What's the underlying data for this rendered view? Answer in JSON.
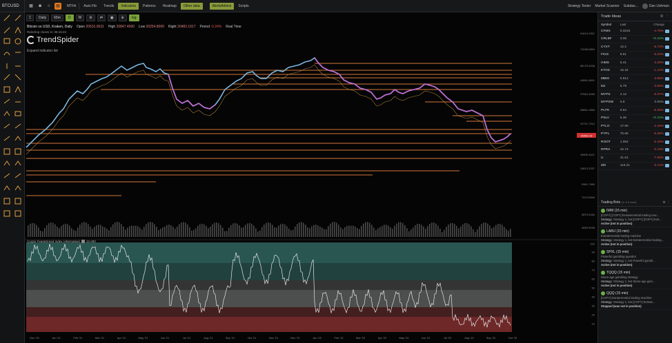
{
  "topbar": {
    "ticker": "BTCUSD",
    "buttons": [
      "MTFA",
      "Auto Fib",
      "Trends",
      "Indicators",
      "Patterns",
      "Heatmap",
      "Other data",
      "AlertsAdvice",
      "Scripts"
    ],
    "right": [
      "Strategy Tester",
      "Market Scanner",
      "Subdas..."
    ],
    "user": "Dan Ushman"
  },
  "chart_toolbar": {
    "interval": "Daily",
    "resolution": "65m",
    "mode_d": "D",
    "mode_w": "W"
  },
  "chart_info": {
    "pair": "Bitcoin vs USD, Kraken, Daily",
    "open_label": "Open",
    "open": "20531.0531",
    "high_label": "High",
    "high": "20847.4000",
    "low_label": "Low",
    "low": "20254.8000",
    "right_label": "Right",
    "right": "20482.1917",
    "period_label": "Period",
    "period": "-0.24%",
    "realtime": "Real Time",
    "rainshop": "Raindrop closes in: 06:15:24",
    "logo": "TrendSpider",
    "expand": "Expand indicator list"
  },
  "indicator": {
    "title": "Crypto Fear&Greed Index (Alternative)",
    "value": "22.000"
  },
  "y_axis_main": [
    "91813.2357",
    "71938.0854",
    "56175.4938",
    "43681.6851",
    "37584.3286",
    "28851.1866",
    "22721.7312",
    "18906.4421",
    "13813.2257",
    "9361.7980",
    "7419.0845",
    "5879.4166",
    "4659.5038"
  ],
  "price_tag": "20482.19",
  "y_axis_ind": [
    "100",
    "90",
    "80",
    "70",
    "60",
    "50",
    "40",
    "30",
    "20",
    "10"
  ],
  "x_axis": [
    "Dec '20",
    "Jan '21",
    "Feb '21",
    "Mar '21",
    "Apr '21",
    "May '21",
    "Jun '21",
    "Jul '21",
    "Aug '21",
    "Sep '21",
    "Oct '21",
    "Nov '21",
    "Dec '21",
    "Jan '22",
    "Feb '22",
    "Mar '22",
    "Apr '22",
    "May '22",
    "Jun '22",
    "Jul '22",
    "Aug '22",
    "Sep '22",
    "Oct '22"
  ],
  "sidebar": {
    "title": "Trade Ideas",
    "columns": [
      "Symbol",
      "Last",
      "Change"
    ],
    "rows": [
      {
        "sym": "CFMS",
        "last": "0.3245",
        "chg": "-4.76%",
        "dir": "neg"
      },
      {
        "sym": "CRLBF",
        "last": "3.06",
        "chg": "+0.23%",
        "dir": "pos"
      },
      {
        "sym": "CYXT",
        "last": "12.2",
        "chg": "-5.72%",
        "dir": "neg"
      },
      {
        "sym": "FIGS",
        "last": "9.61",
        "chg": "-5.23%",
        "dir": "neg"
      },
      {
        "sym": "HIMS",
        "last": "5.41",
        "chg": "-3.39%",
        "dir": "neg"
      },
      {
        "sym": "KTOS",
        "last": "15.34",
        "chg": "-1.14%",
        "dir": "neg"
      },
      {
        "sym": "MBIO",
        "last": "0.612",
        "chg": "-3.65%",
        "dir": "neg"
      },
      {
        "sym": "MJ",
        "last": "5.79",
        "chg": "-3.80%",
        "dir": "neg"
      },
      {
        "sym": "MYPS",
        "last": "4.12",
        "chg": "-6.37%",
        "dir": "neg"
      },
      {
        "sym": "MYPSW",
        "last": "0.9",
        "chg": "0.00%",
        "dir": "zero"
      },
      {
        "sym": "PLTR",
        "last": "8.64",
        "chg": "-5.25%",
        "dir": "neg"
      },
      {
        "sym": "PSLV",
        "last": "6.36",
        "chg": "+0.10%",
        "dir": "pos"
      },
      {
        "sym": "PTLO",
        "last": "17.90",
        "chg": "-2.18%",
        "dir": "neg"
      },
      {
        "sym": "PYPL",
        "last": "70.65",
        "chg": "-5.28%",
        "dir": "neg"
      },
      {
        "sym": "ROOT",
        "last": "1.054",
        "chg": "-5.18%",
        "dir": "neg"
      },
      {
        "sym": "RPRX",
        "last": "42.74",
        "chg": "-0.19%",
        "dir": "neg"
      },
      {
        "sym": "U",
        "last": "41.61",
        "chg": "-7.58%",
        "dir": "neg"
      },
      {
        "sym": "ZM",
        "last": "116.21",
        "chg": "-3.13%",
        "dir": "neg"
      }
    ]
  },
  "bots": {
    "title": "Trading Bots",
    "subtitle": "(4 of 5 used)",
    "items": [
      {
        "title": "IWM (15 min)",
        "desc": "[COPY] [COPY] Extraterrestrial trading mac...",
        "strategy_label": "Strategy:",
        "strategy": "Strategy 1, bot [COPY] [COPY] Extr...",
        "status": "Active (not in position)"
      },
      {
        "title": "LABU (15 min)",
        "desc": "Extraterrestrial trading machine",
        "strategy_label": "Strategy:",
        "strategy": "Strategy 1, bot Extraterrestrial trading...",
        "status": "Active (not in position)"
      },
      {
        "title": "SPXL (15 min)",
        "desc": "Powerful gambling quanbot",
        "strategy_label": "Strategy:",
        "strategy": "Strategy 1, bot Powerful gambl...",
        "status": "Active (not in position)"
      },
      {
        "title": "TQQQ (15 min)",
        "desc": "Stone-age gambling strategy",
        "strategy_label": "Strategy:",
        "strategy": "Strategy 1, bot Stone-age gam...",
        "status": "Active (not in position)"
      },
      {
        "title": "QQQ (15 min)",
        "desc": "[COPY] Extraterrestrial trading machine",
        "strategy_label": "Strategy:",
        "strategy": "Strategy 1, bot [COPY] Extrate...",
        "status": "Stopped (was not in position)"
      }
    ]
  },
  "colors": {
    "background": "#050505",
    "sr_line": "#e07a3a",
    "price_up": "#7ab8e0",
    "price_down": "#c070d0",
    "greed_zone": "#2d5a55",
    "fear_zone": "#6a2a2a",
    "neutral_zone": "#555555"
  }
}
